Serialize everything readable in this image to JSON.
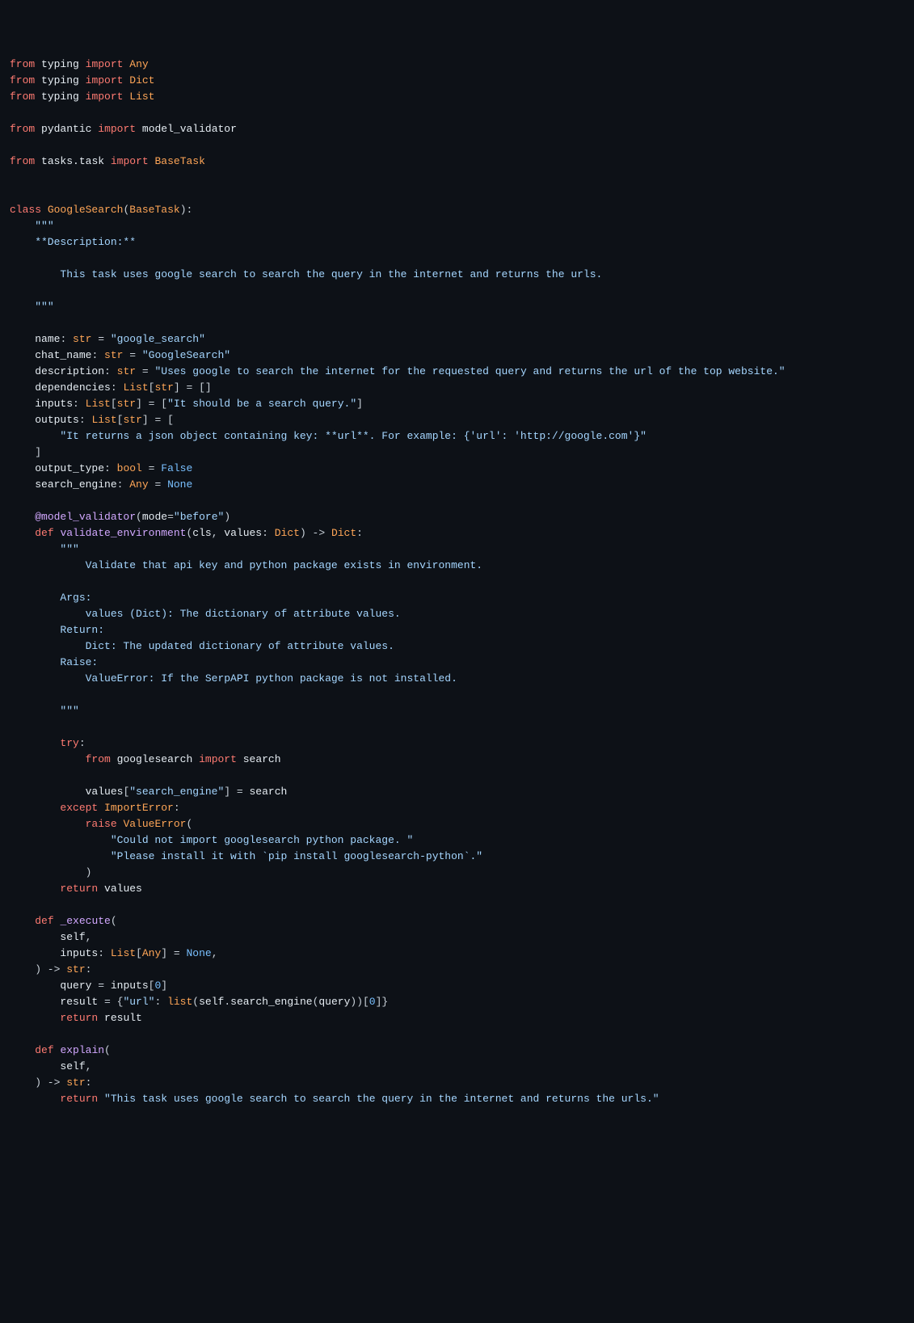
{
  "lines": {
    "l1": [
      [
        "kw",
        "from"
      ],
      [
        "op",
        " "
      ],
      [
        "mod",
        "typing"
      ],
      [
        "op",
        " "
      ],
      [
        "kw",
        "import"
      ],
      [
        "op",
        " "
      ],
      [
        "cls",
        "Any"
      ]
    ],
    "l2": [
      [
        "kw",
        "from"
      ],
      [
        "op",
        " "
      ],
      [
        "mod",
        "typing"
      ],
      [
        "op",
        " "
      ],
      [
        "kw",
        "import"
      ],
      [
        "op",
        " "
      ],
      [
        "cls",
        "Dict"
      ]
    ],
    "l3": [
      [
        "kw",
        "from"
      ],
      [
        "op",
        " "
      ],
      [
        "mod",
        "typing"
      ],
      [
        "op",
        " "
      ],
      [
        "kw",
        "import"
      ],
      [
        "op",
        " "
      ],
      [
        "cls",
        "List"
      ]
    ],
    "l4": [
      [
        "op",
        ""
      ]
    ],
    "l5": [
      [
        "kw",
        "from"
      ],
      [
        "op",
        " "
      ],
      [
        "mod",
        "pydantic"
      ],
      [
        "op",
        " "
      ],
      [
        "kw",
        "import"
      ],
      [
        "op",
        " "
      ],
      [
        "mod",
        "model_validator"
      ]
    ],
    "l6": [
      [
        "op",
        ""
      ]
    ],
    "l7": [
      [
        "kw",
        "from"
      ],
      [
        "op",
        " "
      ],
      [
        "mod",
        "tasks.task"
      ],
      [
        "op",
        " "
      ],
      [
        "kw",
        "import"
      ],
      [
        "op",
        " "
      ],
      [
        "cls",
        "BaseTask"
      ]
    ],
    "l8": [
      [
        "op",
        ""
      ]
    ],
    "l9": [
      [
        "op",
        ""
      ]
    ],
    "l10": [
      [
        "kw",
        "class"
      ],
      [
        "op",
        " "
      ],
      [
        "cls",
        "GoogleSearch"
      ],
      [
        "op",
        "("
      ],
      [
        "cls",
        "BaseTask"
      ],
      [
        "op",
        "):"
      ]
    ],
    "l11": [
      [
        "op",
        "    "
      ],
      [
        "str",
        "\"\"\""
      ]
    ],
    "l12": [
      [
        "str",
        "    **Description:**"
      ]
    ],
    "l13": [
      [
        "str",
        ""
      ]
    ],
    "l14": [
      [
        "str",
        "        This task uses google search to search the query in the internet and returns the urls."
      ]
    ],
    "l15": [
      [
        "str",
        ""
      ]
    ],
    "l16": [
      [
        "op",
        "    "
      ],
      [
        "str",
        "\"\"\""
      ]
    ],
    "l17": [
      [
        "op",
        ""
      ]
    ],
    "l18": [
      [
        "op",
        "    "
      ],
      [
        "mod",
        "name"
      ],
      [
        "op",
        ": "
      ],
      [
        "cls",
        "str"
      ],
      [
        "op",
        " = "
      ],
      [
        "str",
        "\"google_search\""
      ]
    ],
    "l19": [
      [
        "op",
        "    "
      ],
      [
        "mod",
        "chat_name"
      ],
      [
        "op",
        ": "
      ],
      [
        "cls",
        "str"
      ],
      [
        "op",
        " = "
      ],
      [
        "str",
        "\"GoogleSearch\""
      ]
    ],
    "l20": [
      [
        "op",
        "    "
      ],
      [
        "mod",
        "description"
      ],
      [
        "op",
        ": "
      ],
      [
        "cls",
        "str"
      ],
      [
        "op",
        " = "
      ],
      [
        "str",
        "\"Uses google to search the internet for the requested query and returns the url of the top website.\""
      ]
    ],
    "l21": [
      [
        "op",
        "    "
      ],
      [
        "mod",
        "dependencies"
      ],
      [
        "op",
        ": "
      ],
      [
        "cls",
        "List"
      ],
      [
        "op",
        "["
      ],
      [
        "cls",
        "str"
      ],
      [
        "op",
        "] = []"
      ]
    ],
    "l22": [
      [
        "op",
        "    "
      ],
      [
        "mod",
        "inputs"
      ],
      [
        "op",
        ": "
      ],
      [
        "cls",
        "List"
      ],
      [
        "op",
        "["
      ],
      [
        "cls",
        "str"
      ],
      [
        "op",
        "] = ["
      ],
      [
        "str",
        "\"It should be a search query.\""
      ],
      [
        "op",
        "]"
      ]
    ],
    "l23": [
      [
        "op",
        "    "
      ],
      [
        "mod",
        "outputs"
      ],
      [
        "op",
        ": "
      ],
      [
        "cls",
        "List"
      ],
      [
        "op",
        "["
      ],
      [
        "cls",
        "str"
      ],
      [
        "op",
        "] = ["
      ]
    ],
    "l24": [
      [
        "op",
        "        "
      ],
      [
        "str",
        "\"It returns a json object containing key: **url**. For example: {'url': 'http://google.com'}\""
      ]
    ],
    "l25": [
      [
        "op",
        "    ]"
      ]
    ],
    "l26": [
      [
        "op",
        "    "
      ],
      [
        "mod",
        "output_type"
      ],
      [
        "op",
        ": "
      ],
      [
        "cls",
        "bool"
      ],
      [
        "op",
        " = "
      ],
      [
        "const",
        "False"
      ]
    ],
    "l27": [
      [
        "op",
        "    "
      ],
      [
        "mod",
        "search_engine"
      ],
      [
        "op",
        ": "
      ],
      [
        "cls",
        "Any"
      ],
      [
        "op",
        " = "
      ],
      [
        "const",
        "None"
      ]
    ],
    "l28": [
      [
        "op",
        ""
      ]
    ],
    "l29": [
      [
        "op",
        "    "
      ],
      [
        "fn",
        "@model_validator"
      ],
      [
        "op",
        "("
      ],
      [
        "param",
        "mode"
      ],
      [
        "op",
        "="
      ],
      [
        "str",
        "\"before\""
      ],
      [
        "op",
        ")"
      ]
    ],
    "l30": [
      [
        "op",
        "    "
      ],
      [
        "kw",
        "def"
      ],
      [
        "op",
        " "
      ],
      [
        "fn",
        "validate_environment"
      ],
      [
        "op",
        "("
      ],
      [
        "param",
        "cls"
      ],
      [
        "op",
        ", "
      ],
      [
        "param",
        "values"
      ],
      [
        "op",
        ": "
      ],
      [
        "cls",
        "Dict"
      ],
      [
        "op",
        ") -> "
      ],
      [
        "cls",
        "Dict"
      ],
      [
        "op",
        ":"
      ]
    ],
    "l31": [
      [
        "op",
        "        "
      ],
      [
        "str",
        "\"\"\""
      ]
    ],
    "l32": [
      [
        "str",
        "            Validate that api key and python package exists in environment."
      ]
    ],
    "l33": [
      [
        "str",
        ""
      ]
    ],
    "l34": [
      [
        "str",
        "        Args:"
      ]
    ],
    "l35": [
      [
        "str",
        "            values (Dict): The dictionary of attribute values."
      ]
    ],
    "l36": [
      [
        "str",
        "        Return:"
      ]
    ],
    "l37": [
      [
        "str",
        "            Dict: The updated dictionary of attribute values."
      ]
    ],
    "l38": [
      [
        "str",
        "        Raise:"
      ]
    ],
    "l39": [
      [
        "str",
        "            ValueError: If the SerpAPI python package is not installed."
      ]
    ],
    "l40": [
      [
        "str",
        ""
      ]
    ],
    "l41": [
      [
        "op",
        "        "
      ],
      [
        "str",
        "\"\"\""
      ]
    ],
    "l42": [
      [
        "op",
        ""
      ]
    ],
    "l43": [
      [
        "op",
        "        "
      ],
      [
        "kw",
        "try"
      ],
      [
        "op",
        ":"
      ]
    ],
    "l44": [
      [
        "op",
        "            "
      ],
      [
        "kw",
        "from"
      ],
      [
        "op",
        " "
      ],
      [
        "mod",
        "googlesearch"
      ],
      [
        "op",
        " "
      ],
      [
        "kw",
        "import"
      ],
      [
        "op",
        " "
      ],
      [
        "mod",
        "search"
      ]
    ],
    "l45": [
      [
        "op",
        ""
      ]
    ],
    "l46": [
      [
        "op",
        "            "
      ],
      [
        "mod",
        "values"
      ],
      [
        "op",
        "["
      ],
      [
        "str",
        "\"search_engine\""
      ],
      [
        "op",
        "] = "
      ],
      [
        "mod",
        "search"
      ]
    ],
    "l47": [
      [
        "op",
        "        "
      ],
      [
        "kw",
        "except"
      ],
      [
        "op",
        " "
      ],
      [
        "cls",
        "ImportError"
      ],
      [
        "op",
        ":"
      ]
    ],
    "l48": [
      [
        "op",
        "            "
      ],
      [
        "kw",
        "raise"
      ],
      [
        "op",
        " "
      ],
      [
        "cls",
        "ValueError"
      ],
      [
        "op",
        "("
      ]
    ],
    "l49": [
      [
        "op",
        "                "
      ],
      [
        "str",
        "\"Could not import googlesearch python package. \""
      ]
    ],
    "l50": [
      [
        "op",
        "                "
      ],
      [
        "str",
        "\"Please install it with `pip install googlesearch-python`.\""
      ]
    ],
    "l51": [
      [
        "op",
        "            )"
      ]
    ],
    "l52": [
      [
        "op",
        "        "
      ],
      [
        "kw",
        "return"
      ],
      [
        "op",
        " "
      ],
      [
        "mod",
        "values"
      ]
    ],
    "l53": [
      [
        "op",
        ""
      ]
    ],
    "l54": [
      [
        "op",
        "    "
      ],
      [
        "kw",
        "def"
      ],
      [
        "op",
        " "
      ],
      [
        "fn",
        "_execute"
      ],
      [
        "op",
        "("
      ]
    ],
    "l55": [
      [
        "op",
        "        "
      ],
      [
        "param",
        "self"
      ],
      [
        "op",
        ","
      ]
    ],
    "l56": [
      [
        "op",
        "        "
      ],
      [
        "param",
        "inputs"
      ],
      [
        "op",
        ": "
      ],
      [
        "cls",
        "List"
      ],
      [
        "op",
        "["
      ],
      [
        "cls",
        "Any"
      ],
      [
        "op",
        "] = "
      ],
      [
        "const",
        "None"
      ],
      [
        "op",
        ","
      ]
    ],
    "l57": [
      [
        "op",
        "    ) -> "
      ],
      [
        "cls",
        "str"
      ],
      [
        "op",
        ":"
      ]
    ],
    "l58": [
      [
        "op",
        "        "
      ],
      [
        "mod",
        "query"
      ],
      [
        "op",
        " = "
      ],
      [
        "mod",
        "inputs"
      ],
      [
        "op",
        "["
      ],
      [
        "num",
        "0"
      ],
      [
        "op",
        "]"
      ]
    ],
    "l59": [
      [
        "op",
        "        "
      ],
      [
        "mod",
        "result"
      ],
      [
        "op",
        " = {"
      ],
      [
        "str",
        "\"url\""
      ],
      [
        "op",
        ": "
      ],
      [
        "cls",
        "list"
      ],
      [
        "op",
        "("
      ],
      [
        "mod",
        "self"
      ],
      [
        "op",
        "."
      ],
      [
        "mod",
        "search_engine"
      ],
      [
        "op",
        "("
      ],
      [
        "mod",
        "query"
      ],
      [
        "op",
        "))["
      ],
      [
        "num",
        "0"
      ],
      [
        "op",
        "]}"
      ]
    ],
    "l60": [
      [
        "op",
        "        "
      ],
      [
        "kw",
        "return"
      ],
      [
        "op",
        " "
      ],
      [
        "mod",
        "result"
      ]
    ],
    "l61": [
      [
        "op",
        ""
      ]
    ],
    "l62": [
      [
        "op",
        "    "
      ],
      [
        "kw",
        "def"
      ],
      [
        "op",
        " "
      ],
      [
        "fn",
        "explain"
      ],
      [
        "op",
        "("
      ]
    ],
    "l63": [
      [
        "op",
        "        "
      ],
      [
        "param",
        "self"
      ],
      [
        "op",
        ","
      ]
    ],
    "l64": [
      [
        "op",
        "    ) -> "
      ],
      [
        "cls",
        "str"
      ],
      [
        "op",
        ":"
      ]
    ],
    "l65": [
      [
        "op",
        "        "
      ],
      [
        "kw",
        "return"
      ],
      [
        "op",
        " "
      ],
      [
        "str",
        "\"This task uses google search to search the query in the internet and returns the urls.\""
      ]
    ]
  },
  "line_order": [
    "l1",
    "l2",
    "l3",
    "l4",
    "l5",
    "l6",
    "l7",
    "l8",
    "l9",
    "l10",
    "l11",
    "l12",
    "l13",
    "l14",
    "l15",
    "l16",
    "l17",
    "l18",
    "l19",
    "l20",
    "l21",
    "l22",
    "l23",
    "l24",
    "l25",
    "l26",
    "l27",
    "l28",
    "l29",
    "l30",
    "l31",
    "l32",
    "l33",
    "l34",
    "l35",
    "l36",
    "l37",
    "l38",
    "l39",
    "l40",
    "l41",
    "l42",
    "l43",
    "l44",
    "l45",
    "l46",
    "l47",
    "l48",
    "l49",
    "l50",
    "l51",
    "l52",
    "l53",
    "l54",
    "l55",
    "l56",
    "l57",
    "l58",
    "l59",
    "l60",
    "l61",
    "l62",
    "l63",
    "l64",
    "l65"
  ]
}
